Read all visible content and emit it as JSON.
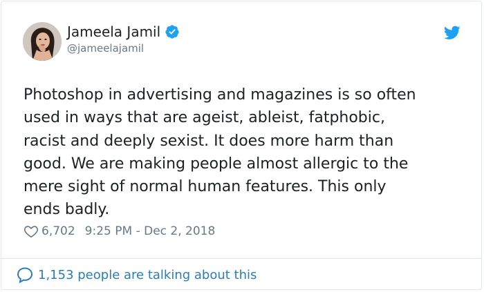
{
  "author": {
    "name": "Jameela Jamil",
    "handle": "@jameelajamil",
    "verified": true,
    "avatar_icon": "avatar-photo"
  },
  "tweet": {
    "text": "Photoshop in advertising and magazines is so often\nused in ways that are ageist, ableist, fatphobic,\nracist and deeply sexist. It does more harm than\ngood. We are making people almost allergic to the\nmere sight of normal human features. This only\nends badly.",
    "likes": "6,702",
    "timestamp": "9:25 PM - Dec 2, 2018"
  },
  "footer": {
    "talking": "1,153 people are talking about this"
  },
  "colors": {
    "accent": "#1da1f2",
    "link": "#2b7bb9",
    "muted": "#697882",
    "border": "#e1e8ed",
    "text": "#1c2022"
  },
  "icons": {
    "brand": "twitter-bird-icon",
    "verified": "verified-badge-icon",
    "like": "heart-icon",
    "reply": "speech-bubble-icon"
  }
}
